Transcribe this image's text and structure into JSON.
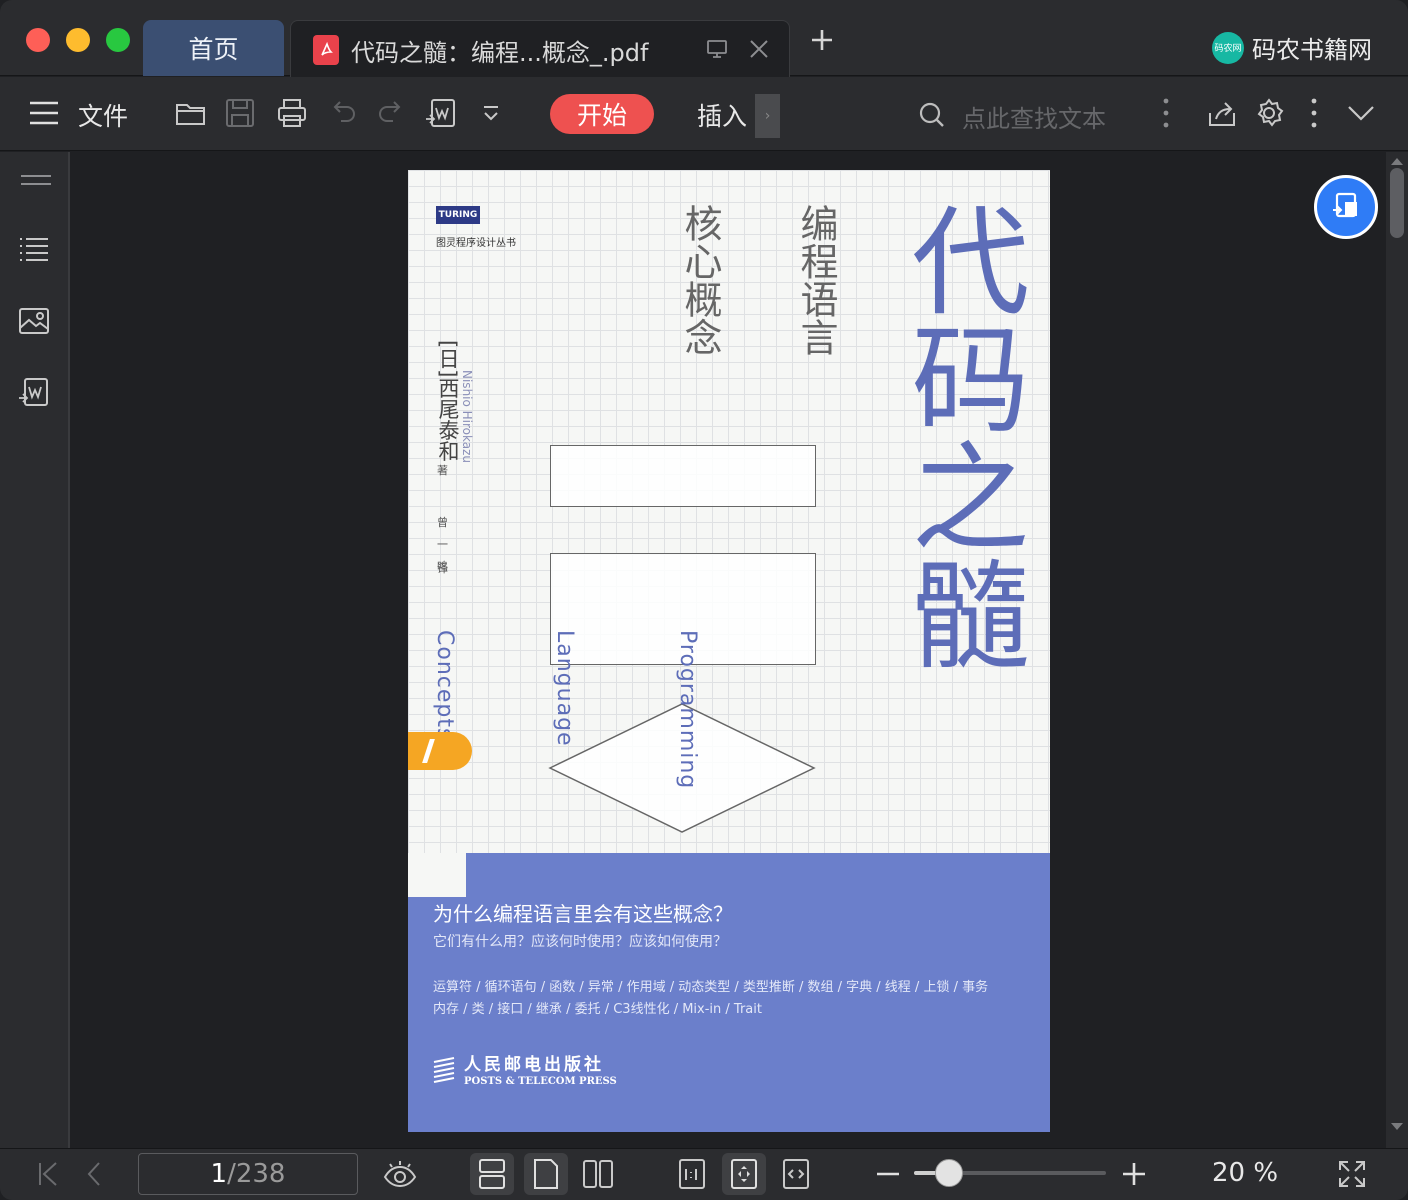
{
  "window": {
    "tabs": [
      {
        "label": "首页"
      },
      {
        "label": "代码之髓：编程...概念_.pdf"
      }
    ],
    "brand": {
      "logo_text": "码农网",
      "name": "码农书籍网"
    }
  },
  "toolbar": {
    "file_label": "文件",
    "start_label": "开始",
    "insert_label": "插入",
    "search_placeholder": "点此查找文本"
  },
  "book": {
    "publisher_badge": "TURING",
    "series": "图灵程序设计丛书",
    "title": "代码之髓",
    "subtitle_line1": "编程语言",
    "subtitle_line2": "核心概念",
    "author_prefix": "[日]",
    "author": "西尾泰和",
    "author_en": "Nishio Hirokazu",
    "author_role": "著",
    "translator": "曾一鸣",
    "translator_role": "译",
    "word_programming": "Programming",
    "word_language": "Language",
    "word_concepts": "Concepts",
    "question": "为什么编程语言里会有这些概念？",
    "question_sub": "它们有什么用？应该何时使用？应该如何使用？",
    "topics_line1": "运算符 / 循环语句 / 函数 / 异常 / 作用域 / 动态类型 / 类型推断 / 数组 / 字典 / 线程 / 上锁 / 事务",
    "topics_line2": "内存 / 类 / 接口 / 继承 / 委托 / C3线性化 / Mix-in /  Trait",
    "publisher": "人民邮电出版社",
    "publisher_en": "POSTS & TELECOM PRESS"
  },
  "status": {
    "current_page": "1",
    "total_pages": "/238",
    "zoom_label": "20 %",
    "zoom_fraction": 0.18
  },
  "colors": {
    "accent_red": "#ee5150",
    "tab_active": "#3b4f72",
    "cover_blue": "#6b7fcb",
    "float_blue": "#2f7cf6"
  }
}
